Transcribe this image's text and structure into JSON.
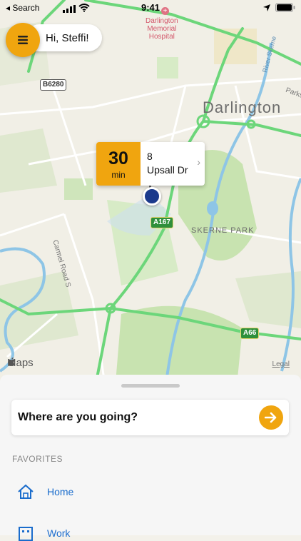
{
  "status_bar": {
    "back_label": "◂ Search",
    "time": "9:41"
  },
  "header": {
    "greeting": "Hi, Steffi!"
  },
  "map": {
    "city_label": "Darlington",
    "park_label": "SKERNE PARK",
    "hospital_label": "Darlington\nMemorial\nHospital",
    "street_label_carmel": "Carmel Road S",
    "street_label_parks": "Parks",
    "river_label": "River Skerne",
    "road_b6280": "B6280",
    "road_a167": "A167",
    "road_a66": "A66",
    "attribution": "Maps",
    "legal": "Legal"
  },
  "eta": {
    "minutes": "30",
    "unit": "min",
    "house_number": "8",
    "street": "Upsall Dr"
  },
  "sheet": {
    "search_prompt": "Where are you going?",
    "favorites_title": "FAVORITES",
    "favorites": [
      {
        "label": "Home",
        "icon": "home-icon"
      },
      {
        "label": "Work",
        "icon": "work-icon"
      }
    ]
  },
  "colors": {
    "accent": "#f0a50f",
    "link": "#1a6ccc",
    "major_road": "#6cd67a",
    "water": "#8ec5e6",
    "park": "#c8e3b0"
  }
}
